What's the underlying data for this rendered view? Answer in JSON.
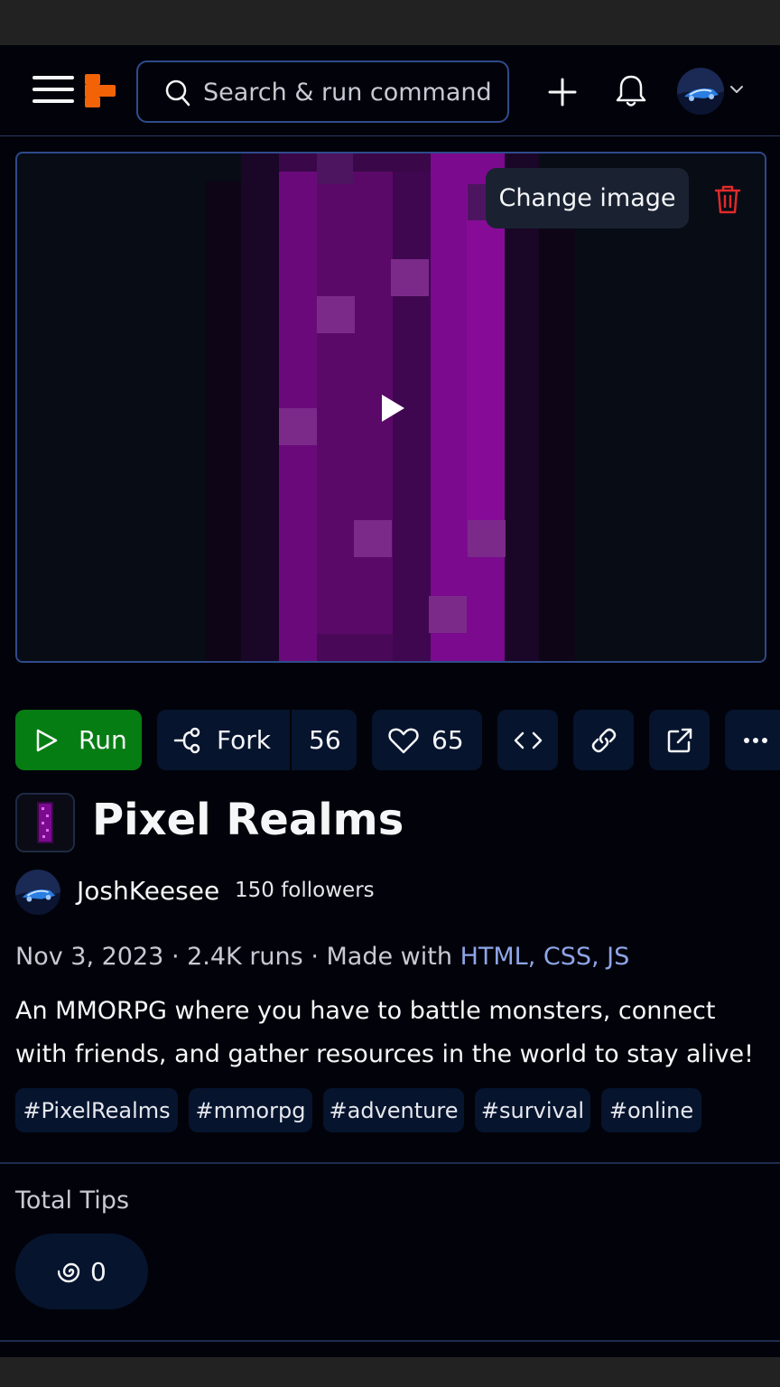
{
  "header": {
    "search_placeholder": "Search & run commands",
    "icons": {
      "menu": "hamburger-menu-icon",
      "logo": "replit-logo",
      "search": "search-icon",
      "create": "plus-icon",
      "notifications": "bell-icon",
      "account": "user-avatar",
      "account_menu": "chevron-down-icon"
    }
  },
  "cover": {
    "change_image_label": "Change image",
    "icons": {
      "delete": "trash-icon",
      "play": "play-icon"
    },
    "colors": {
      "accent": "#7b0a8e",
      "delete": "#e02a2a"
    }
  },
  "actions": {
    "run_label": "Run",
    "fork_label": "Fork",
    "fork_count": "56",
    "like_count": "65",
    "icons": [
      "code-icon",
      "link-icon",
      "external-link-icon",
      "more-icon"
    ],
    "colors": {
      "run": "#067d13",
      "button_bg": "#06142e"
    }
  },
  "project": {
    "title": "Pixel Realms",
    "author": "JoshKeesee",
    "followers": "150 followers",
    "date": "Nov 3, 2023",
    "runs": "2.4K runs",
    "made_with_label": "Made with",
    "technologies": "HTML, CSS, JS",
    "description": "An MMORPG where you have to battle monsters, connect with friends, and gather resources in the world to stay alive!",
    "tags": [
      "#PixelRealms",
      "#mmorpg",
      "#adventure",
      "#survival",
      "#online"
    ]
  },
  "tips": {
    "label": "Total Tips",
    "count": "0",
    "icon": "cycles-spiral-icon"
  }
}
